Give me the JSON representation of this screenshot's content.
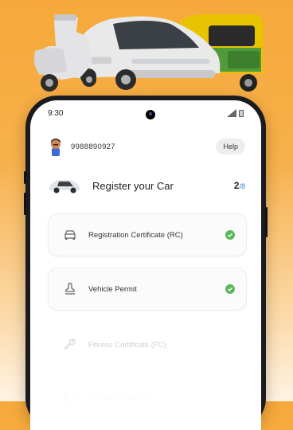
{
  "status_bar": {
    "time": "9:30"
  },
  "user": {
    "phone_number": "9988890927",
    "help_label": "Help"
  },
  "register": {
    "title": "Register your Car",
    "completed": "2",
    "total": "/8"
  },
  "documents": [
    {
      "label": "Registration Certificate (RC)",
      "icon": "car-front-icon",
      "status": "completed"
    },
    {
      "label": "Vehicle Permit",
      "icon": "stamp-icon",
      "status": "completed"
    },
    {
      "label": "Fitness Certificate (FC)",
      "icon": "wrench-icon",
      "status": "pending"
    },
    {
      "label": "Vehicle Insurance",
      "icon": "shield-icon",
      "status": "pending"
    }
  ],
  "colors": {
    "background": "#f6a93a",
    "check": "#5cb85c",
    "progress_total": "#3a7bd5"
  }
}
